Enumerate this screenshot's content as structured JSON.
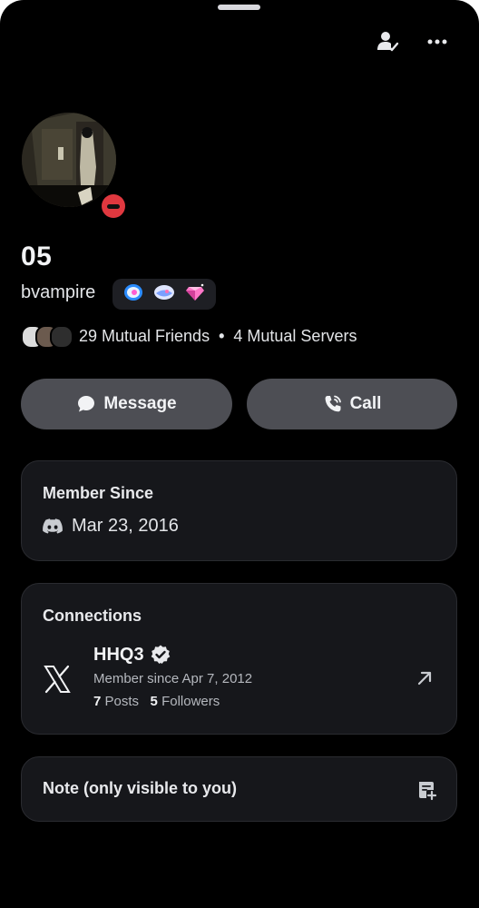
{
  "profile": {
    "display_name": "05",
    "username": "bvampire",
    "badges": [
      "nitro-boost-badge",
      "shield-badge",
      "gem-badge"
    ],
    "mutual_friends": "29 Mutual Friends",
    "mutual_separator": "•",
    "mutual_servers": "4 Mutual Servers",
    "status": "do-not-disturb"
  },
  "actions": {
    "message_label": "Message",
    "call_label": "Call"
  },
  "member_since": {
    "title": "Member Since",
    "date": "Mar 23, 2016"
  },
  "connections": {
    "title": "Connections",
    "items": [
      {
        "service": "X",
        "icon": "x-logo-icon",
        "name": "HHQ3",
        "verified": true,
        "since": "Member since Apr 7, 2012",
        "posts_count": "7",
        "posts_label": "Posts",
        "followers_count": "5",
        "followers_label": "Followers"
      }
    ]
  },
  "note": {
    "label": "Note (only visible to you)"
  },
  "colors": {
    "background": "#000000",
    "card": "#16171b",
    "button": "#4d4e54",
    "dnd_red": "#e0383f"
  }
}
